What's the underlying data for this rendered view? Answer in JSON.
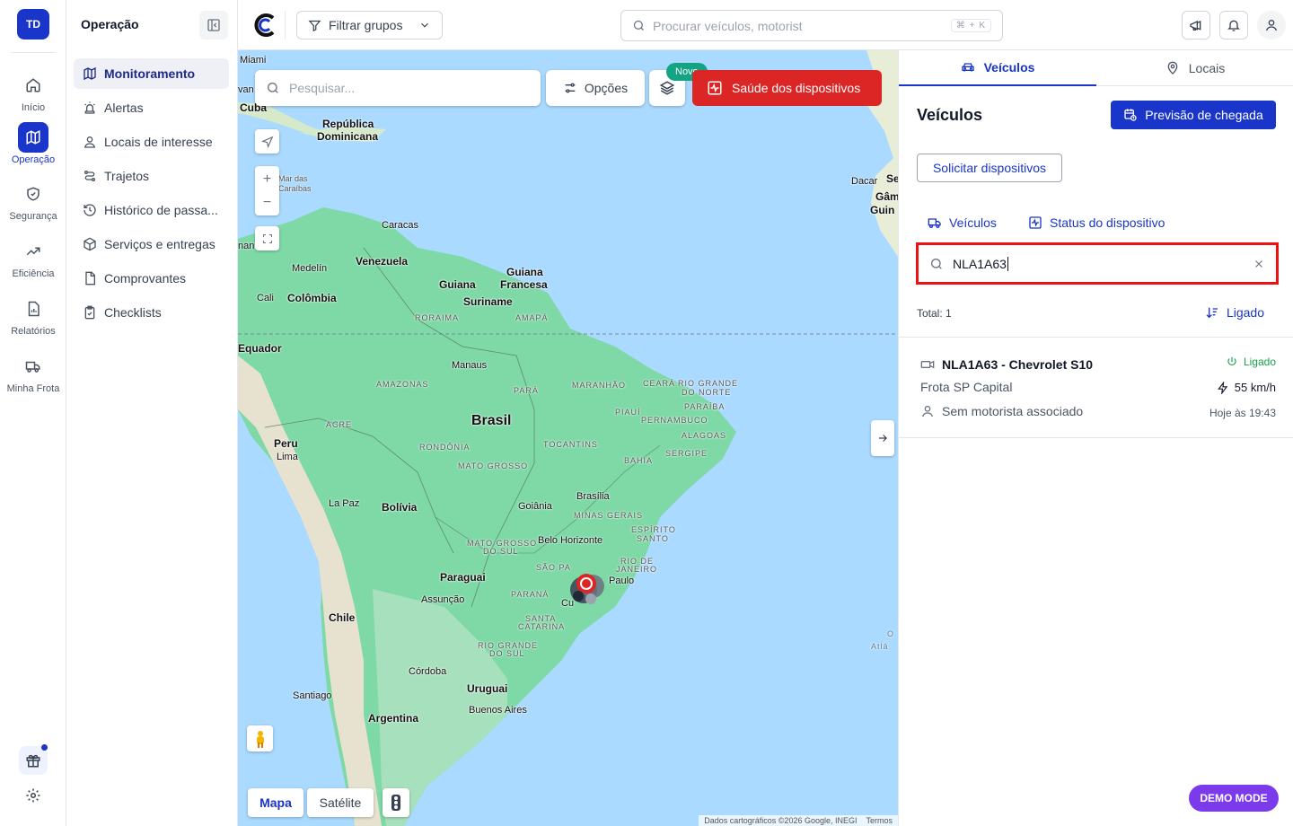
{
  "user_initials": "TD",
  "rail": {
    "items": [
      {
        "label": "Início",
        "icon": "home-icon"
      },
      {
        "label": "Operação",
        "icon": "map-icon"
      },
      {
        "label": "Segurança",
        "icon": "shield-icon"
      },
      {
        "label": "Eficiência",
        "icon": "trending-up-icon"
      },
      {
        "label": "Relatórios",
        "icon": "report-icon"
      },
      {
        "label": "Minha Frota",
        "icon": "truck-icon"
      }
    ]
  },
  "sidebar": {
    "title": "Operação",
    "items": [
      {
        "label": "Monitoramento",
        "icon": "map-icon"
      },
      {
        "label": "Alertas",
        "icon": "siren-icon"
      },
      {
        "label": "Locais de interesse",
        "icon": "location-user-icon"
      },
      {
        "label": "Trajetos",
        "icon": "route-icon"
      },
      {
        "label": "Histórico de passa...",
        "icon": "history-icon"
      },
      {
        "label": "Serviços e entregas",
        "icon": "package-icon"
      },
      {
        "label": "Comprovantes",
        "icon": "file-icon"
      },
      {
        "label": "Checklists",
        "icon": "clipboard-check-icon"
      }
    ]
  },
  "topbar": {
    "filter_label": "Filtrar grupos",
    "search_placeholder": "Procurar veículos, motorist",
    "shortcut": "⌘ + K"
  },
  "map": {
    "search_placeholder": "Pesquisar...",
    "options_label": "Opções",
    "new_badge": "Novo",
    "health_label": "Saúde dos dispositivos",
    "map_type_map": "Mapa",
    "map_type_satellite": "Satélite",
    "attribution": "Dados cartográficos ©2026 Google, INEGI",
    "terms": "Termos",
    "labels": {
      "miami": "Miami",
      "cuba": "Cuba",
      "republica": "República",
      "dominicana": "Dominicana",
      "mar_das": "Mar das",
      "caraibas": "Caraíbas",
      "caracas": "Caracas",
      "medelin": "Medelín",
      "venezuela": "Venezuela",
      "guiana": "Guiana",
      "guiana_francesa_1": "Guiana",
      "guiana_francesa_2": "Francesa",
      "suriname": "Suriname",
      "cali": "Cali",
      "colombia": "Colômbia",
      "roraima": "RORAIMA",
      "amapa": "AMAPÁ",
      "equador": "Equador",
      "manaus": "Manaus",
      "amazonas": "AMAZONAS",
      "para": "PARÁ",
      "maranhao": "MARANHÃO",
      "ceara": "CEARÁ",
      "rio_grande": "RIO GRANDE",
      "do_norte": "DO NORTE",
      "paraiba": "PARAÍBA",
      "piaui": "PIAUÍ",
      "pernambuco": "PERNAMBUCO",
      "alagoas": "ALAGOAS",
      "sergipe": "SERGIPE",
      "brasil": "Brasil",
      "acre": "ACRE",
      "rondonia": "RONDÔNIA",
      "tocantins": "TOCANTINS",
      "bahia": "BAHIA",
      "peru": "Peru",
      "lima": "Lima",
      "mato_grosso": "MATO GROSSO",
      "brasilia": "Brasília",
      "goiania": "Goiânia",
      "minas_gerais": "MINAS GERAIS",
      "la_paz": "La Paz",
      "bolivia": "Bolívia",
      "espirito": "ESPÍRITO",
      "santo": "SANTO",
      "mato_grosso_sul_1": "MATO GROSSO",
      "mato_grosso_sul_2": "DO SUL",
      "belo_horizonte": "Belo Horizonte",
      "rio_de": "RIO DE",
      "janeiro": "JANEIRO",
      "sao_pa": "SÃO PA",
      "paulo": "Paulo",
      "paraguai": "Paraguai",
      "assuncao": "Assunção",
      "parana": "PARANÁ",
      "cu": "Cu",
      "chile": "Chile",
      "santa": "SANTA",
      "catarina": "CATARINA",
      "rgs_1": "RIO GRANDE",
      "rgs_2": "DO SUL",
      "cordoba": "Córdoba",
      "uruguai": "Uruguai",
      "santiago": "Santiago",
      "buenos_aires": "Buenos Aires",
      "argentina": "Argentina",
      "dacar": "Dacar",
      "se": "Se",
      "gam": "Gâm",
      "guin": "Guin",
      "o": "O",
      "atla": "Atlâ",
      "van": "van",
      "nan": "nan"
    }
  },
  "panel": {
    "tab_vehicles": "Veículos",
    "tab_places": "Locais",
    "title": "Veículos",
    "eta_button": "Previsão de chegada",
    "request_button": "Solicitar dispositivos",
    "subtab_vehicles": "Veículos",
    "subtab_status": "Status do dispositivo",
    "search_value": "NLA1A63",
    "total": "Total: 1",
    "sort_label": "Ligado",
    "vehicles": [
      {
        "title": "NLA1A63 - Chevrolet S10",
        "fleet": "Frota SP Capital",
        "driver": "Sem motorista associado",
        "status": "Ligado",
        "speed": "55 km/h",
        "time": "Hoje às 19:43"
      }
    ]
  },
  "demo_mode": "DEMO MODE",
  "colors": {
    "brand": "#1a35c9",
    "danger": "#dc2626",
    "success": "#16a34a",
    "novo": "#14a383",
    "demo": "#7c3aed"
  }
}
